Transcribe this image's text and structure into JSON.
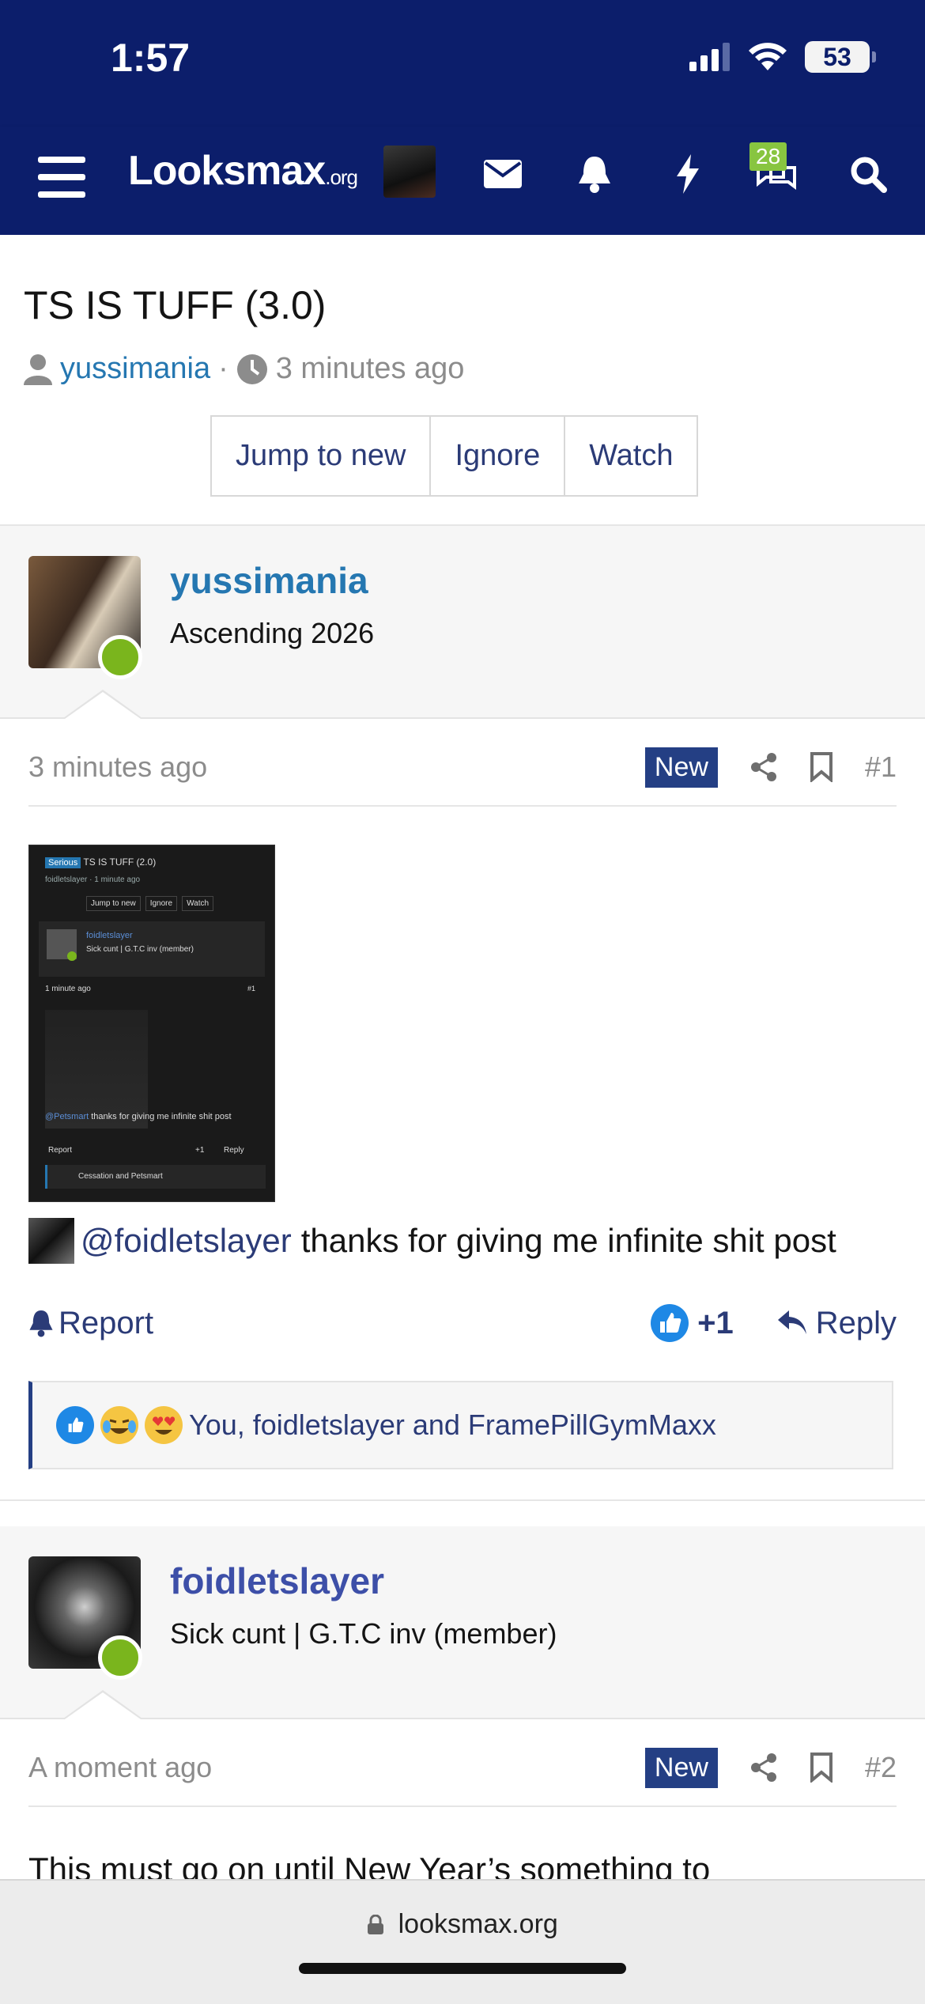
{
  "status_bar": {
    "time": "1:57",
    "battery": "53"
  },
  "nav": {
    "logo_main": "Looksmax",
    "logo_suffix": ".org",
    "badge_count": "28"
  },
  "thread": {
    "title": "TS IS TUFF (3.0)",
    "author": "yussimania",
    "separator": "·",
    "time": "3 minutes ago",
    "buttons": [
      "Jump to new",
      "Ignore",
      "Watch"
    ]
  },
  "posts": [
    {
      "username": "yussimania",
      "user_title": "Ascending 2026",
      "time": "3 minutes ago",
      "new_label": "New",
      "number": "#1",
      "screenshot": {
        "tag": "Serious",
        "title": "TS IS TUFF (2.0)",
        "meta": "foidletslayer · 1 minute ago",
        "buttons": [
          "Jump to new",
          "Ignore",
          "Watch"
        ],
        "inner_user": "foidletslayer",
        "inner_title": "Sick cunt | G.T.C inv (member)",
        "inner_time": "1 minute ago",
        "inner_number": "#1",
        "inner_mention": "@Petsmart",
        "inner_text": "thanks for giving me infinite shit post",
        "inner_report": "Report",
        "inner_like": "+1",
        "inner_reply": "Reply",
        "inner_reactions": "Cessation and Petsmart"
      },
      "mention": "@foidletslayer",
      "text": "thanks for giving me infinite shit post",
      "report_label": "Report",
      "like_count": "+1",
      "reply_label": "Reply",
      "reactions_text": "You, foidletslayer and FramePillGymMaxx"
    },
    {
      "username": "foidletslayer",
      "user_title": "Sick cunt | G.T.C inv (member)",
      "time": "A moment ago",
      "new_label": "New",
      "number": "#2",
      "text_preview": "This must go on until New Year’s something to"
    }
  ],
  "browser": {
    "url": "looksmax.org"
  },
  "colors": {
    "nav_bg": "#0c1e6b",
    "link": "#2577b1",
    "accent": "#243f84",
    "online": "#7ab51d",
    "badge": "#88c540"
  }
}
